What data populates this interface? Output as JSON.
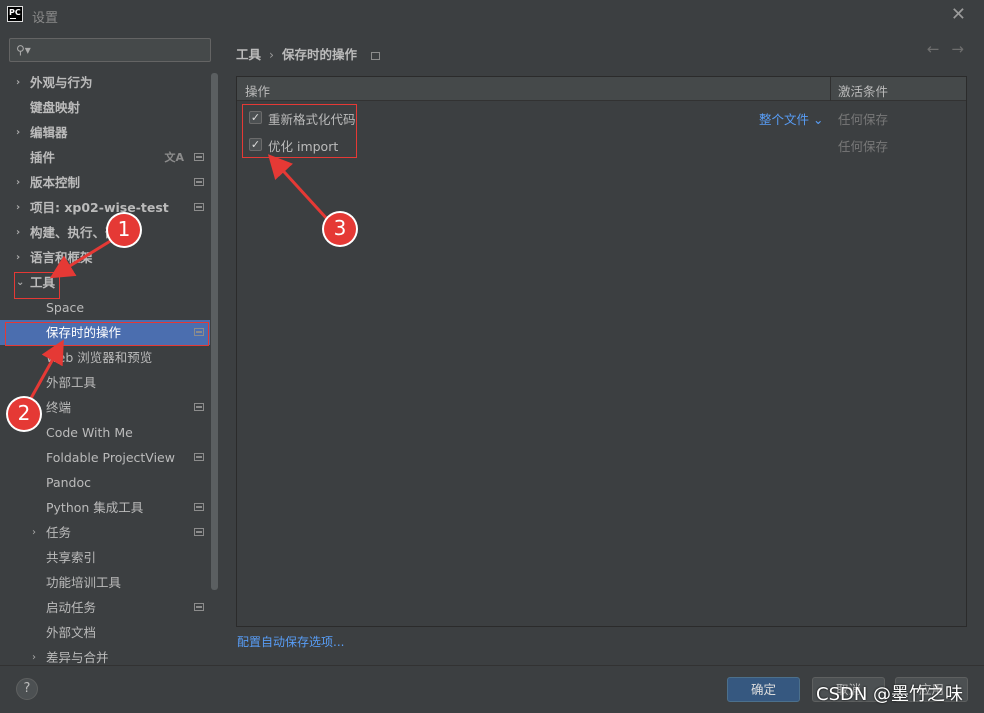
{
  "window": {
    "app_icon": "PC",
    "title": "设置",
    "close_icon": "close-icon"
  },
  "sidebar": {
    "search": {
      "placeholder": "",
      "icon": "search-icon"
    },
    "items": [
      {
        "label": "外观与行为",
        "arrow": "›",
        "bold": true,
        "cfg": false
      },
      {
        "label": "键盘映射",
        "arrow": "",
        "bold": true,
        "cfg": false
      },
      {
        "label": "编辑器",
        "arrow": "›",
        "bold": true,
        "cfg": false
      },
      {
        "label": "插件",
        "arrow": "",
        "bold": true,
        "cfg": true,
        "translate": "文A"
      },
      {
        "label": "版本控制",
        "arrow": "›",
        "bold": true,
        "cfg": true
      },
      {
        "label": "项目: xp02-wise-test",
        "arrow": "›",
        "bold": true,
        "cfg": true
      },
      {
        "label": "构建、执行、部",
        "arrow": "›",
        "bold": true,
        "cfg": false
      },
      {
        "label": "语言和框架",
        "arrow": "›",
        "bold": true,
        "cfg": false
      },
      {
        "label": "工具",
        "arrow": "⌄",
        "bold": true,
        "cfg": false
      },
      {
        "label": "Space",
        "arrow": "",
        "bold": false,
        "cfg": false
      },
      {
        "label": "保存时的操作",
        "arrow": "",
        "bold": false,
        "cfg": true,
        "selected": true
      },
      {
        "label": "Web 浏览器和预览",
        "arrow": "",
        "bold": false,
        "cfg": false
      },
      {
        "label": "外部工具",
        "arrow": "",
        "bold": false,
        "cfg": false
      },
      {
        "label": "终端",
        "arrow": "",
        "bold": false,
        "cfg": true
      },
      {
        "label": "Code With Me",
        "arrow": "",
        "bold": false,
        "cfg": false
      },
      {
        "label": "Foldable ProjectView",
        "arrow": "",
        "bold": false,
        "cfg": true
      },
      {
        "label": "Pandoc",
        "arrow": "",
        "bold": false,
        "cfg": false
      },
      {
        "label": "Python 集成工具",
        "arrow": "",
        "bold": false,
        "cfg": true
      },
      {
        "label": "任务",
        "arrow": "›",
        "bold": false,
        "cfg": true
      },
      {
        "label": "共享索引",
        "arrow": "",
        "bold": false,
        "cfg": false
      },
      {
        "label": "功能培训工具",
        "arrow": "",
        "bold": false,
        "cfg": false
      },
      {
        "label": "启动任务",
        "arrow": "",
        "bold": false,
        "cfg": true
      },
      {
        "label": "外部文档",
        "arrow": "",
        "bold": false,
        "cfg": false
      },
      {
        "label": "差异与合并",
        "arrow": "›",
        "bold": false,
        "cfg": false
      }
    ]
  },
  "main": {
    "breadcrumb": {
      "parent": "工具",
      "separator": "›",
      "current": "保存时的操作"
    },
    "nav": {
      "back": "←",
      "forward": "→"
    },
    "table": {
      "col_actions": "操作",
      "col_conditions": "激活条件",
      "rows": [
        {
          "checked": true,
          "label": "重新格式化代码",
          "scope": "整个文件 ⌄",
          "condition": "任何保存"
        },
        {
          "checked": true,
          "label": "优化 import",
          "scope": "",
          "condition": "任何保存"
        }
      ]
    },
    "link": "配置自动保存选项..."
  },
  "footer": {
    "help": "?",
    "ok": "确定",
    "cancel": "取消",
    "apply": "应用"
  },
  "annotations": {
    "n1": "1",
    "n2": "2",
    "n3": "3",
    "color": "#e53935"
  },
  "watermark": "CSDN @墨竹之味"
}
